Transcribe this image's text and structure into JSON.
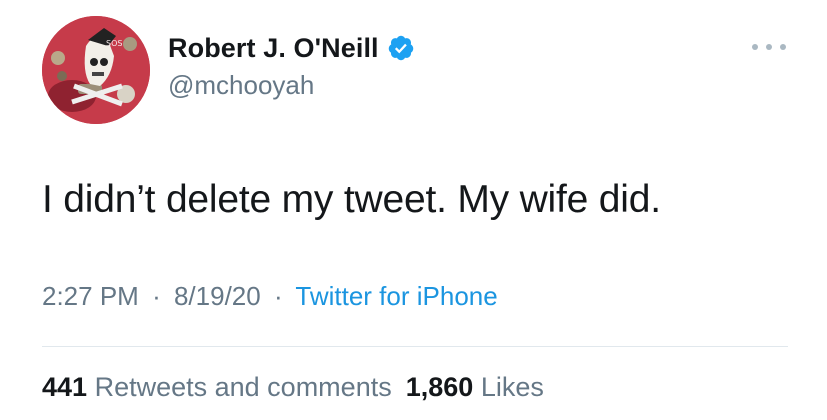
{
  "user": {
    "display_name": "Robert J. O'Neill",
    "handle": "@mchooyah",
    "verified": true
  },
  "tweet": {
    "text": "I didn’t delete my tweet. My wife did."
  },
  "meta": {
    "time": "2:27 PM",
    "date": "8/19/20",
    "separator": "·",
    "source": "Twitter for iPhone"
  },
  "stats": {
    "retweets_count": "441",
    "retweets_label": "Retweets and comments",
    "likes_count": "1,860",
    "likes_label": "Likes"
  },
  "colors": {
    "text": "#14171a",
    "secondary": "#657786",
    "link": "#1b95e0",
    "verified": "#1da1f2",
    "divider": "#e1e8ed"
  },
  "icons": {
    "avatar": "profile-photo",
    "verified": "verified-badge-icon",
    "more": "more-options-icon"
  }
}
